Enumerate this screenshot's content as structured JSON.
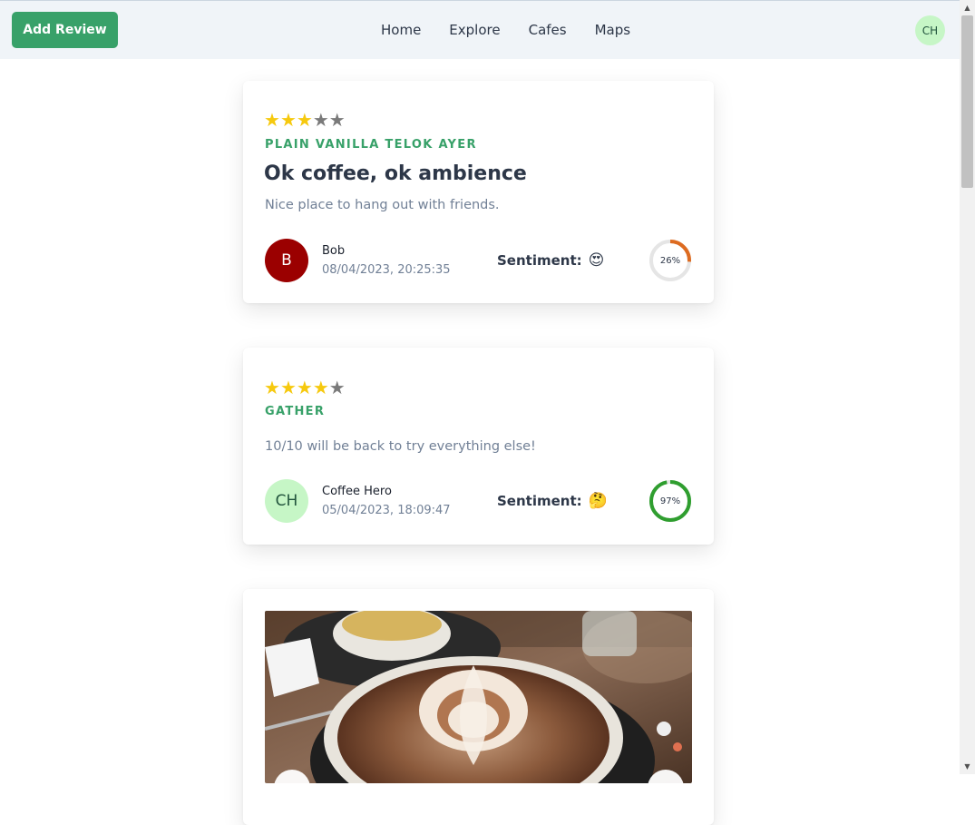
{
  "header": {
    "add_review_label": "Add Review",
    "nav": [
      "Home",
      "Explore",
      "Cafes",
      "Maps"
    ],
    "user_initials": "CH"
  },
  "reviews": [
    {
      "rating": 3,
      "cafe": "Plain Vanilla Telok Ayer",
      "title": "Ok coffee, ok ambience",
      "body": "Nice place to hang out with friends.",
      "author_initial": "B",
      "author": "Bob",
      "date": "08/04/2023, 20:25:35",
      "sentiment_label": "Sentiment:",
      "sentiment_emoji": "😍",
      "score_label": "26%",
      "score": 0.26,
      "score_color": "#dd6b20",
      "avatar_bg": "#9b0000",
      "avatar_fg": "#ffffff"
    },
    {
      "rating": 4,
      "cafe": "Gather",
      "title": "",
      "body": "10/10 will be back to try everything else!",
      "author_initial": "CH",
      "author": "Coffee Hero",
      "date": "05/04/2023, 18:09:47",
      "sentiment_label": "Sentiment:",
      "sentiment_emoji": "🤔",
      "score_label": "97%",
      "score": 0.97,
      "score_color": "#2f9e2f",
      "avatar_bg": "#c6f6c6",
      "avatar_fg": "#22543d"
    }
  ],
  "colors": {
    "accent": "#38a169",
    "star_on": "#f6c90e",
    "star_off": "#7a7a7a"
  },
  "icons": {
    "scroll_up": "▲",
    "scroll_down": "▼",
    "star": "★"
  }
}
